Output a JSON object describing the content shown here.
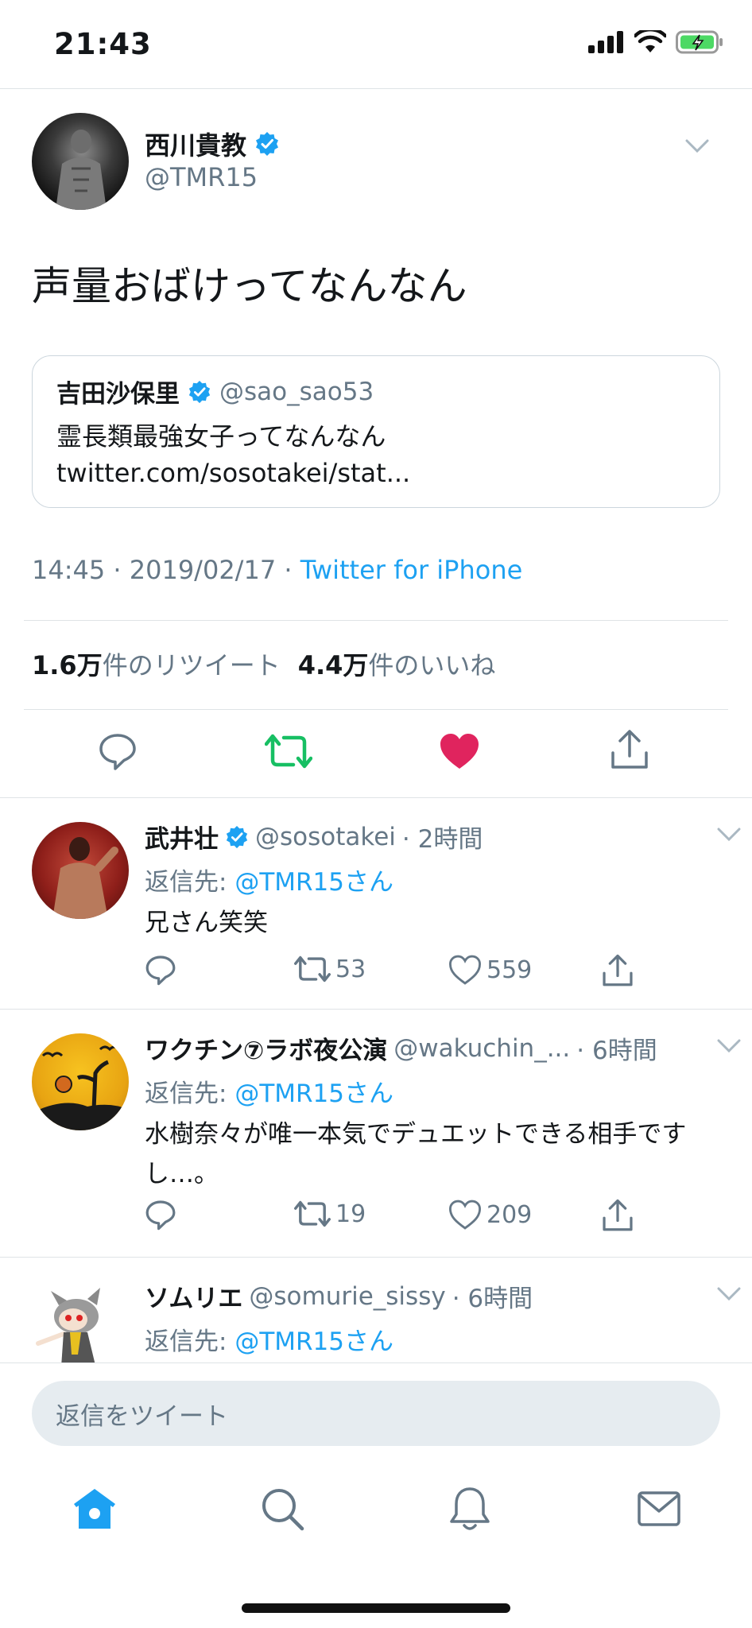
{
  "status_bar": {
    "time": "21:43"
  },
  "tweet": {
    "author_name": "西川貴教",
    "author_handle": "@TMR15",
    "text": "声量おばけってなんなん",
    "quote": {
      "name": "吉田沙保里",
      "handle": "@sao_sao53",
      "text": "霊長類最強女子ってなんなん twitter.com/sosotakei/stat..."
    },
    "time": "14:45 · 2019/02/17 · ",
    "source": "Twitter for iPhone",
    "retweets_count": "1.6万",
    "retweets_label": "件のリツイート",
    "likes_count": "4.4万",
    "likes_label": "件のいいね"
  },
  "replies": [
    {
      "name": "武井壮",
      "handle": "@sosotakei",
      "time": "· 2時間",
      "reply_to_label": "返信先: ",
      "reply_to": "@TMR15さん",
      "text": "兄さん笑笑",
      "retweets": "53",
      "likes": "559"
    },
    {
      "name": "ワクチン⑦ラボ夜公演",
      "handle": "@wakuchin_...",
      "time": "· 6時間",
      "reply_to_label": "返信先: ",
      "reply_to": "@TMR15さん",
      "text": "水樹奈々が唯一本気でデュエットできる相手ですし…。",
      "retweets": "19",
      "likes": "209"
    },
    {
      "name": "ソムリエ",
      "handle": "@somurie_sissy",
      "time": "· 6時間",
      "reply_to_label": "返信先: ",
      "reply_to": "@TMR15さん"
    }
  ],
  "composer": {
    "placeholder": "返信をツイート"
  },
  "colors": {
    "accent": "#1da1f2",
    "retweet_green": "#17bf63",
    "like_red": "#e0245e",
    "muted": "#657786"
  }
}
